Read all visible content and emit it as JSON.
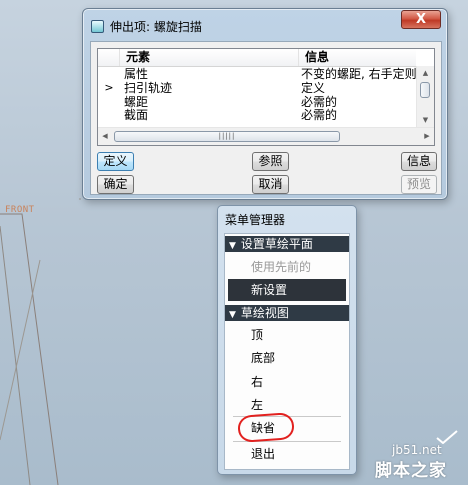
{
  "canvas": {
    "datum_label": "FRONT"
  },
  "dialog": {
    "title": "伸出项: 螺旋扫描",
    "close_symbol": "X",
    "table": {
      "columns": [
        "元素",
        "信息"
      ],
      "rows": [
        {
          "marker": "",
          "element": "属性",
          "info": "不变的螺距, 右手定则"
        },
        {
          "marker": ">",
          "element": "扫引轨迹",
          "info": "定义"
        },
        {
          "marker": "",
          "element": "螺距",
          "info": "必需的"
        },
        {
          "marker": "",
          "element": "截面",
          "info": "必需的"
        }
      ],
      "hscroll_grip": "|||||"
    },
    "buttons": {
      "define": "定义",
      "reference": "参照",
      "info": "信息",
      "ok": "确定",
      "cancel": "取消",
      "preview": "预览"
    }
  },
  "menu_manager": {
    "title": "菜单管理器",
    "sections": [
      {
        "header": "设置草绘平面",
        "items": [
          {
            "label": "使用先前的",
            "state": "disabled"
          },
          {
            "label": "新设置",
            "state": "selected"
          }
        ]
      },
      {
        "header": "草绘视图",
        "items": [
          {
            "label": "顶",
            "state": "normal"
          },
          {
            "label": "底部",
            "state": "normal"
          },
          {
            "label": "右",
            "state": "normal"
          },
          {
            "label": "左",
            "state": "normal"
          },
          {
            "label": "缺省",
            "state": "highlighted"
          },
          {
            "label": "退出",
            "state": "normal"
          }
        ]
      }
    ],
    "annotation_color": "#e2211f"
  },
  "watermark": {
    "url": "jb51.net",
    "logo": "脚本之家"
  }
}
